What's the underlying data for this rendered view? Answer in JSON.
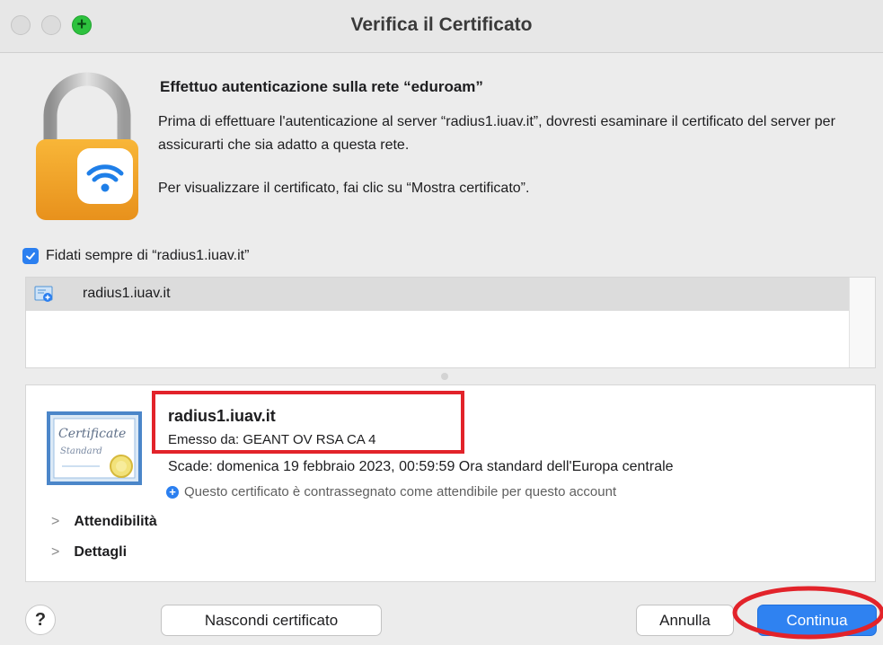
{
  "window": {
    "title": "Verifica il Certificato"
  },
  "header": {
    "heading": "Effettuo autenticazione sulla rete “eduroam”",
    "description": "Prima di effettuare l'autenticazione al server “radius1.iuav.it”, dovresti esaminare il certificato del server per assicurarti che sia adatto a questa rete.",
    "instruction": "Per visualizzare il certificato, fai clic su “Mostra certificato”."
  },
  "trust_checkbox": {
    "label": "Fidati sempre di “radius1.iuav.it”",
    "checked": true
  },
  "certificate_list": {
    "items": [
      {
        "name": "radius1.iuav.it",
        "selected": true
      }
    ]
  },
  "certificate_detail": {
    "name": "radius1.iuav.it",
    "issuer": "Emesso da: GEANT OV RSA CA 4",
    "expiry": "Scade: domenica 19 febbraio 2023, 00:59:59 Ora standard dell'Europa centrale",
    "trust_status": "Questo certificato è contrassegnato come attendibile per questo account",
    "sections": [
      {
        "label": "Attendibilità"
      },
      {
        "label": "Dettagli"
      }
    ]
  },
  "buttons": {
    "help": "?",
    "hide_certificate": "Nascondi certificato",
    "cancel": "Annulla",
    "continue": "Continua"
  },
  "colors": {
    "accent": "#2f82f1",
    "annotation_red": "#e2232a",
    "checkbox": "#2b7ff0"
  }
}
